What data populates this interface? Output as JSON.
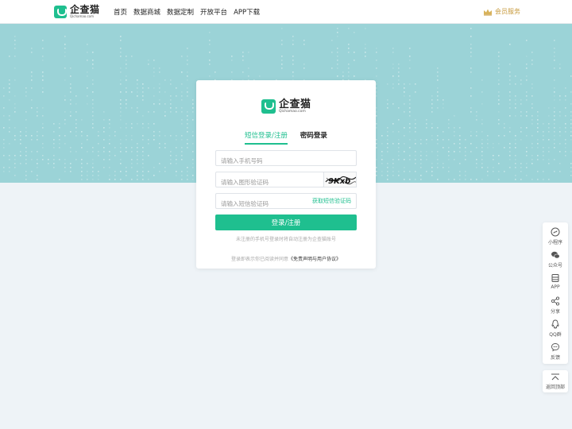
{
  "header": {
    "logo_cn": "企查猫",
    "logo_en": "Qichamao.com",
    "nav": [
      "首页",
      "数据商城",
      "数据定制",
      "开放平台",
      "APP下载"
    ],
    "vip_label": "会员服务"
  },
  "login": {
    "logo_cn": "企查猫",
    "logo_en": "Qichamao.com",
    "tab_sms": "短信登录/注册",
    "tab_password": "密码登录",
    "phone_placeholder": "请输入手机号码",
    "captcha_placeholder": "请输入图形验证码",
    "captcha_text": "9Kxb",
    "sms_placeholder": "请输入短信验证码",
    "get_sms_code": "获取短信验证码",
    "submit": "登录/注册",
    "hint": "未注册的手机号登录时将自动注册为企查猫账号",
    "agree_prefix": "登录即表示你已阅读并同意",
    "agree_link": "《免责声明与用户协议》"
  },
  "sidebar": {
    "items": [
      {
        "label": "小程序",
        "icon": "mini-program-icon"
      },
      {
        "label": "公众号",
        "icon": "wechat-icon"
      },
      {
        "label": "APP",
        "icon": "app-icon"
      },
      {
        "label": "分享",
        "icon": "share-icon"
      },
      {
        "label": "QQ群",
        "icon": "qq-icon"
      },
      {
        "label": "反馈",
        "icon": "feedback-icon"
      }
    ],
    "back_top": "返回顶部"
  },
  "colors": {
    "accent": "#1fbf8f",
    "banner": "#9bd3d7",
    "vip": "#c79a3c"
  }
}
